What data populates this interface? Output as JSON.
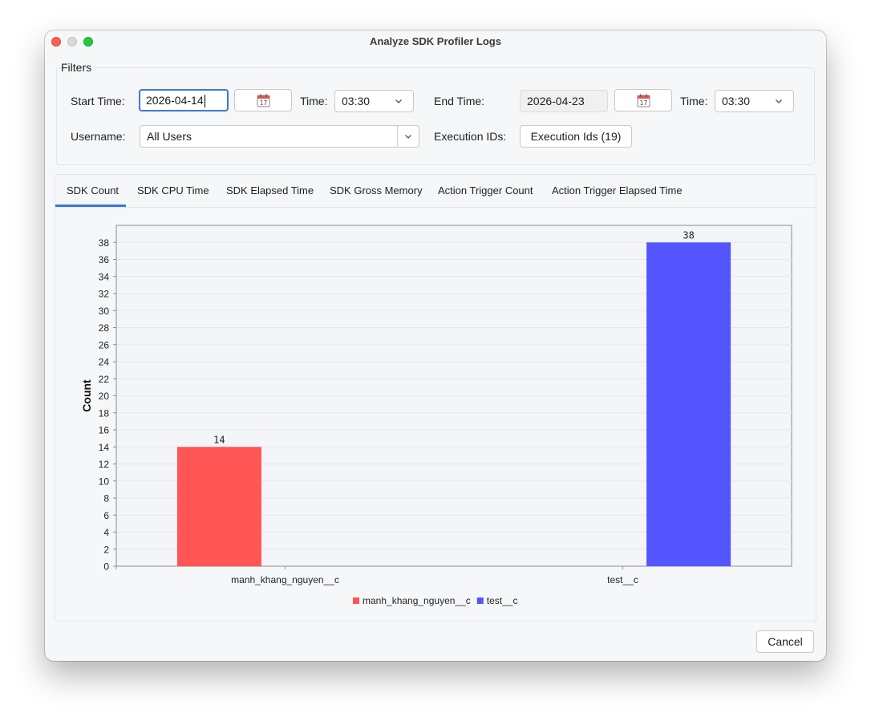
{
  "window": {
    "title": "Analyze SDK Profiler Logs"
  },
  "filters": {
    "group_label": "Filters",
    "start_time_label": "Start Time:",
    "start_date": "2026-04-14",
    "start_time_label2": "Time:",
    "start_time": "03:30",
    "end_time_label": "End Time:",
    "end_date": "2026-04-23",
    "end_time_label2": "Time:",
    "end_time": "03:30",
    "username_label": "Username:",
    "username": "All Users",
    "execution_ids_label": "Execution IDs:",
    "execution_ids_button": "Execution Ids (19)",
    "calendar_icon": "calendar-icon"
  },
  "tabs": [
    {
      "label": "SDK Count",
      "selected": true
    },
    {
      "label": "SDK CPU Time",
      "selected": false
    },
    {
      "label": "SDK Elapsed Time",
      "selected": false
    },
    {
      "label": "SDK Gross Memory",
      "selected": false
    },
    {
      "label": "Action Trigger Count",
      "selected": false
    },
    {
      "label": "Action Trigger Elapsed Time",
      "selected": false
    }
  ],
  "chart_data": {
    "type": "bar",
    "categories": [
      "manh_khang_nguyen__c",
      "test__c"
    ],
    "series": [
      {
        "name": "manh_khang_nguyen__c",
        "color": "#ff5555",
        "values": [
          14,
          null
        ]
      },
      {
        "name": "test__c",
        "color": "#5555ff",
        "values": [
          null,
          38
        ]
      }
    ],
    "ylabel": "Count",
    "xlabel": "",
    "ylim": [
      0,
      40
    ],
    "yticks": [
      0,
      2,
      4,
      6,
      8,
      10,
      12,
      14,
      16,
      18,
      20,
      22,
      24,
      26,
      28,
      30,
      32,
      34,
      36,
      38
    ],
    "data_labels": true,
    "legend": "bottom-center",
    "grid": true
  },
  "footer": {
    "cancel_label": "Cancel"
  }
}
